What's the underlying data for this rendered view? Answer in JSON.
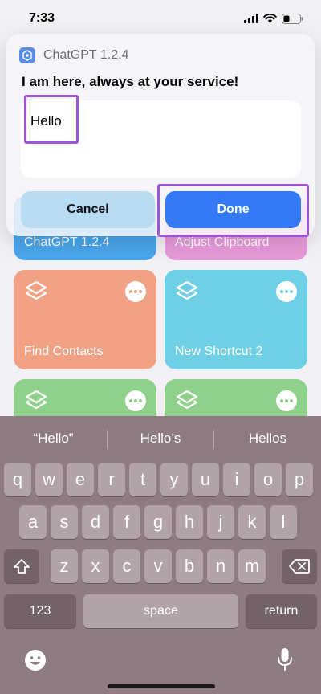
{
  "status_bar": {
    "time": "7:33"
  },
  "background_tiles": [
    {
      "label": "ChatGPT 1.2.4",
      "color": "#4aa6eb"
    },
    {
      "label": "Adjust Clipboard",
      "color": "#e79ad9"
    },
    {
      "label": "Find Contacts",
      "color": "#f1a184",
      "icon": "layers-icon",
      "menu_icon": "more-icon"
    },
    {
      "label": "New Shortcut 2",
      "color": "#6fd0e5",
      "icon": "layers-icon",
      "menu_icon": "more-icon"
    },
    {
      "label": "",
      "color": "#8fd18b",
      "icon": "layers-icon",
      "menu_icon": "more-icon"
    },
    {
      "label": "",
      "color": "#8fd18b",
      "icon": "layers-icon",
      "menu_icon": "more-icon"
    }
  ],
  "dialog": {
    "app_name": "ChatGPT 1.2.4",
    "message": "I am here, always at your service!",
    "input_value": "Hello",
    "cancel_label": "Cancel",
    "done_label": "Done"
  },
  "keyboard": {
    "suggestions": [
      "“Hello”",
      "Hello’s",
      "Hellos"
    ],
    "row1": [
      "q",
      "w",
      "e",
      "r",
      "t",
      "y",
      "u",
      "i",
      "o",
      "p"
    ],
    "row2": [
      "a",
      "s",
      "d",
      "f",
      "g",
      "h",
      "j",
      "k",
      "l"
    ],
    "row3": [
      "z",
      "x",
      "c",
      "v",
      "b",
      "n",
      "m"
    ],
    "numbers_label": "123",
    "space_label": "space",
    "return_label": "return",
    "icons": {
      "shift": "shift-icon",
      "delete": "backspace-icon",
      "emoji": "emoji-icon",
      "mic": "microphone-icon"
    }
  },
  "colors": {
    "accent": "#3478f6",
    "highlight": "#9b55d6"
  }
}
